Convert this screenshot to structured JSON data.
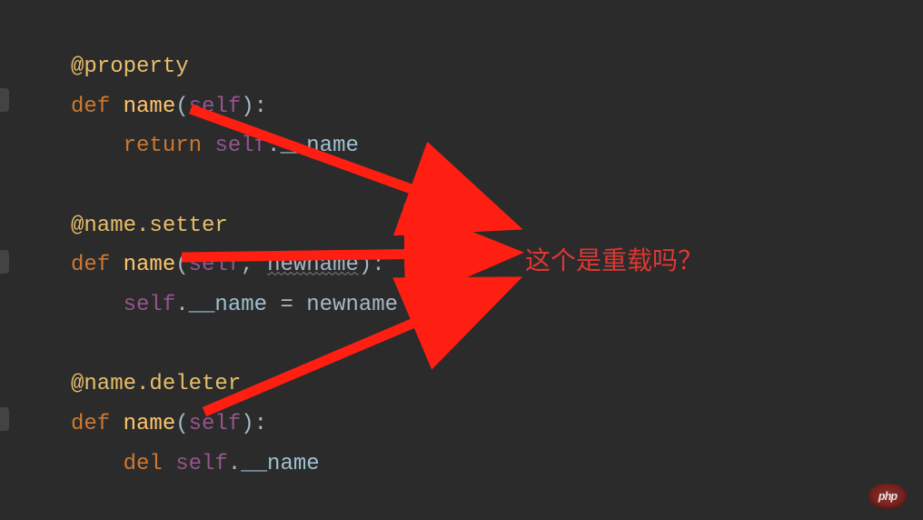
{
  "code": {
    "block1": {
      "decorator": "@property",
      "def": "def",
      "funcname": "name",
      "open": "(",
      "self": "self",
      "close": "):",
      "return": "return",
      "ret_self": "self",
      "ret_dot": ".",
      "ret_member": "__name"
    },
    "block2": {
      "decorator": "@name.setter",
      "def": "def",
      "funcname": "name",
      "open": "(",
      "self": "self",
      "comma": ", ",
      "param": "newname",
      "close": "):",
      "body_self": "self",
      "body_dot": ".",
      "body_member": "__name",
      "eq": " = ",
      "rhs": "newname"
    },
    "block3": {
      "decorator": "@name.deleter",
      "def": "def",
      "funcname": "name",
      "open": "(",
      "self": "self",
      "close": "):",
      "del": "del",
      "del_self": "self",
      "del_dot": ".",
      "del_member": "__name"
    }
  },
  "annotation": {
    "text": "这个是重载吗？"
  },
  "watermark": {
    "logo": "php",
    "text": ""
  },
  "colors": {
    "background": "#2b2b2b",
    "decorator": "#e8bf6a",
    "keyword": "#cc7832",
    "funcname": "#ffc66d",
    "self": "#94558d",
    "default": "#a9b7c6",
    "annotation": "#e03632",
    "arrow": "#ff1f12"
  }
}
